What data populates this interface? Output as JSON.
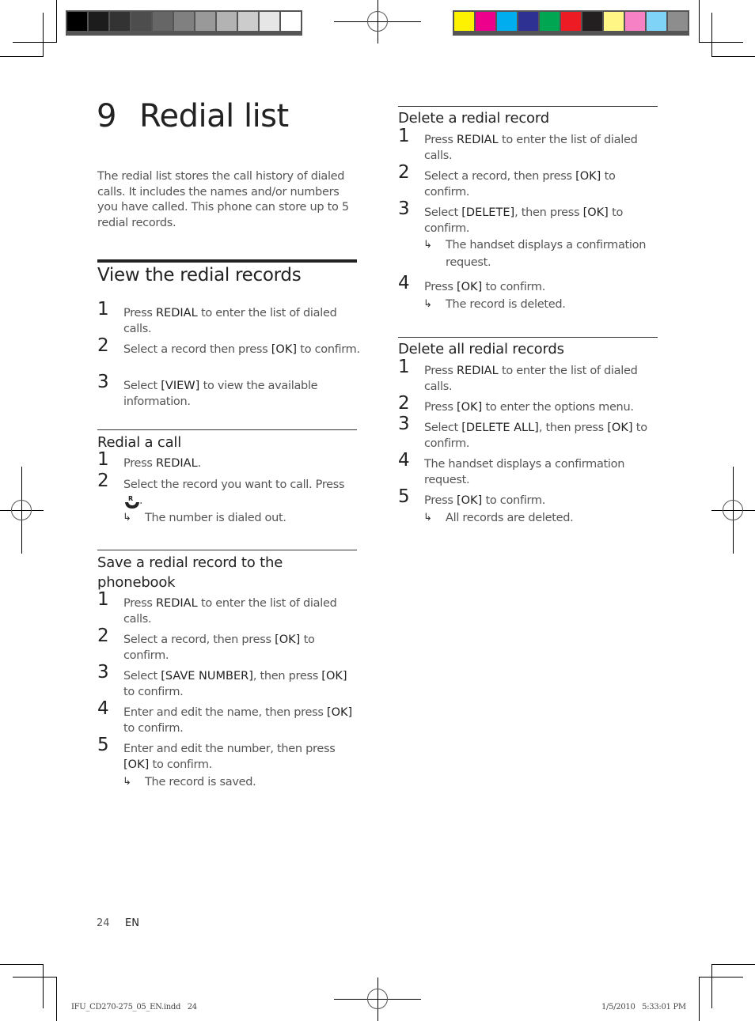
{
  "colors": {
    "grayscale_swatches": [
      "#000000",
      "#1c1c1c",
      "#333333",
      "#4d4d4d",
      "#666666",
      "#808080",
      "#999999",
      "#b3b3b3",
      "#cccccc",
      "#e6e6e6",
      "#ffffff"
    ],
    "color_swatches": [
      "#fff200",
      "#ec008c",
      "#00aeef",
      "#2e3192",
      "#00a651",
      "#ed1c24",
      "#231f20",
      "#fff685",
      "#f682c5",
      "#7fd3f7",
      "#8e8d8d"
    ]
  },
  "chapter": {
    "number": "9",
    "title": "Redial list",
    "intro": "The redial list stores the call history of dialed calls. It includes the names and/or numbers you have called. This phone can store up to 5 redial records."
  },
  "view_section": {
    "heading": "View the redial records",
    "steps": [
      {
        "n": "1",
        "pre": "Press ",
        "key": "REDIAL",
        "post": " to enter the list of dialed calls."
      },
      {
        "n": "2",
        "pre": "Select a record then press ",
        "key": "[OK]",
        "post": " to confirm."
      },
      {
        "n": "3",
        "pre": "Select ",
        "key": "[VIEW]",
        "post": " to view the available information."
      }
    ]
  },
  "redial_call": {
    "heading": "Redial a call",
    "steps": [
      {
        "n": "1",
        "pre": "Press ",
        "key": "REDIAL",
        "post": "."
      },
      {
        "n": "2",
        "pre": "Select the record you want to call. Press",
        "post": "."
      }
    ],
    "result": "The number is dialed out.",
    "icon_letter": "R"
  },
  "save_record": {
    "heading": "Save a redial record to the phonebook",
    "steps": [
      {
        "n": "1",
        "pre": "Press ",
        "key": "REDIAL",
        "post": " to enter the list of dialed calls."
      },
      {
        "n": "2",
        "pre": "Select a record, then press ",
        "key": "[OK]",
        "post": " to confirm."
      },
      {
        "n": "3",
        "pre": "Select ",
        "key": "[SAVE NUMBER]",
        "mid": ", then press ",
        "key2": "[OK]",
        "post": " to confirm."
      },
      {
        "n": "4",
        "pre": "Enter and edit the name, then press ",
        "key": "[OK]",
        "post": " to confirm."
      },
      {
        "n": "5",
        "pre": "Enter and edit the number, then press ",
        "key": "[OK]",
        "post": " to confirm."
      }
    ],
    "result": "The record is saved."
  },
  "delete_record": {
    "heading": "Delete a redial record",
    "steps": [
      {
        "n": "1",
        "pre": "Press ",
        "key": "REDIAL",
        "post": " to enter the list of dialed calls."
      },
      {
        "n": "2",
        "pre": "Select a record, then press ",
        "key": "[OK]",
        "post": " to confirm."
      },
      {
        "n": "3",
        "pre": "Select ",
        "key": "[DELETE]",
        "mid": ", then press ",
        "key2": "[OK]",
        "post": " to confirm."
      },
      {
        "n": "4",
        "pre": "Press ",
        "key": "[OK]",
        "post": " to confirm."
      }
    ],
    "result_3": "The handset displays a confirmation request.",
    "result_4": "The record is deleted."
  },
  "delete_all": {
    "heading": "Delete all redial records",
    "steps": [
      {
        "n": "1",
        "pre": "Press ",
        "key": "REDIAL",
        "post": " to enter the list of dialed calls."
      },
      {
        "n": "2",
        "pre": "Press ",
        "key": "[OK]",
        "post": " to enter the options menu."
      },
      {
        "n": "3",
        "pre": "Select ",
        "key": "[DELETE ALL]",
        "mid": ", then press ",
        "key2": "[OK]",
        "post": " to confirm."
      },
      {
        "n": "4",
        "pre": "The handset displays a confirmation request."
      },
      {
        "n": "5",
        "pre": "Press ",
        "key": "[OK]",
        "post": " to confirm."
      }
    ],
    "result": "All records are deleted."
  },
  "footer": {
    "page_number": "24",
    "language": "EN",
    "slug_file": "IFU_CD270-275_05_EN.indd   24",
    "slug_date": "1/5/2010   5:33:01 PM"
  },
  "result_arrow": "↳"
}
